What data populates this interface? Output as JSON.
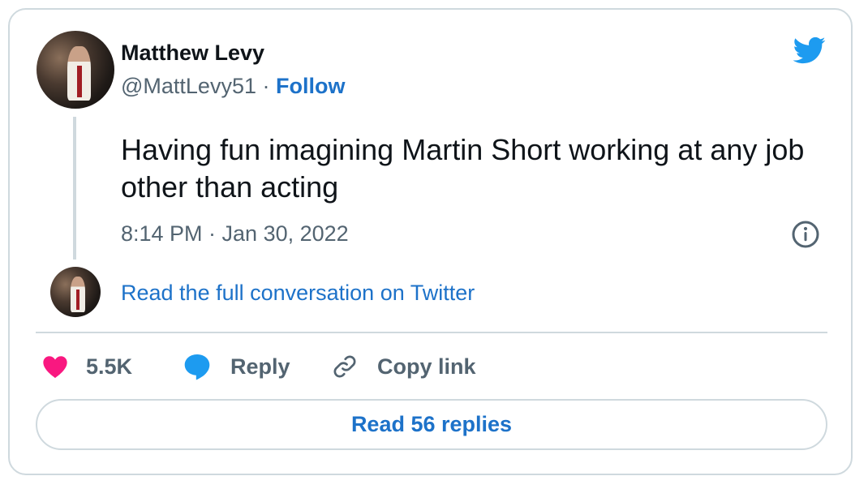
{
  "author": {
    "name": "Matthew Levy",
    "handle": "@MattLevy51",
    "separator": "·",
    "follow_label": "Follow"
  },
  "tweet": {
    "text": "Having fun imagining Martin Short working at any job other than acting",
    "timestamp": "8:14 PM · Jan 30, 2022"
  },
  "conversation": {
    "read_full_label": "Read the full conversation on Twitter"
  },
  "actions": {
    "like_count": "5.5K",
    "reply_label": "Reply",
    "copy_link_label": "Copy link"
  },
  "replies_button": {
    "label": "Read 56 replies"
  },
  "icons": {
    "brand": "twitter-bird-icon",
    "info": "info-icon",
    "like": "heart-icon",
    "reply": "reply-bubble-icon",
    "copy": "link-icon"
  },
  "colors": {
    "brand_blue": "#1d9bf0",
    "link_blue": "#1d72c9",
    "like_pink": "#f91880",
    "text_secondary": "#536471",
    "border": "#cfd9de"
  }
}
